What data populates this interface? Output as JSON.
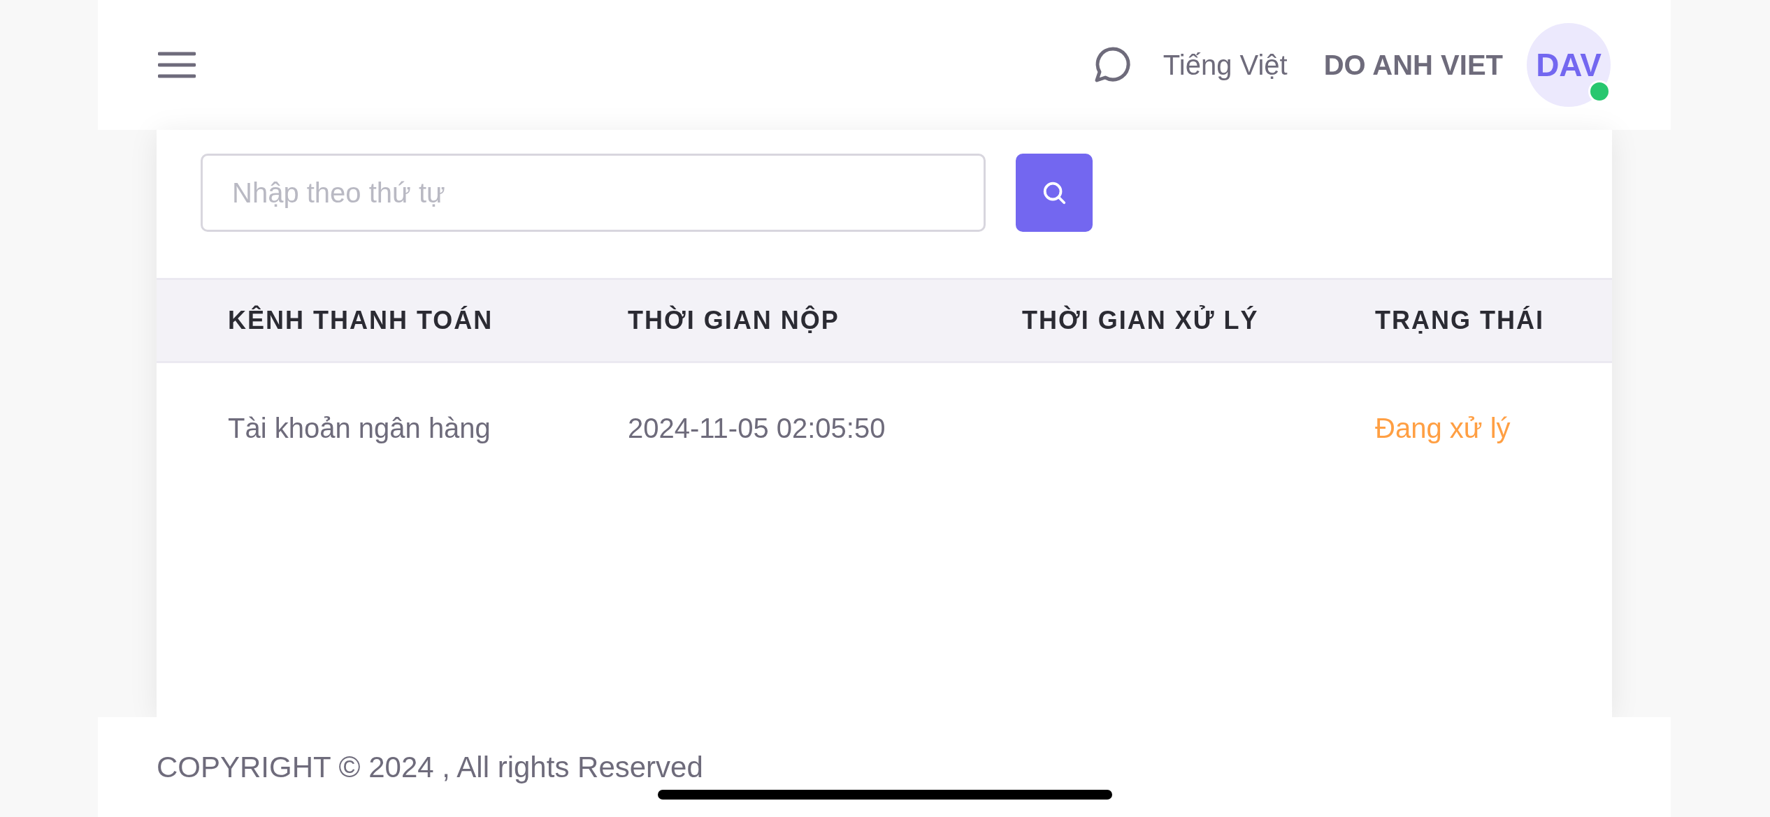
{
  "header": {
    "language": "Tiếng Việt",
    "user_name": "DO ANH VIET",
    "avatar_initials": "DAV",
    "online": true
  },
  "search": {
    "placeholder": "Nhập theo thứ tự"
  },
  "table": {
    "columns": [
      "KÊNH THANH TOÁN",
      "THỜI GIAN NỘP",
      "THỜI GIAN XỬ LÝ",
      "TRẠNG THÁI"
    ],
    "rows": [
      {
        "payment_channel": "Tài khoản ngân hàng",
        "submitted_at": "2024-11-05 02:05:50",
        "status": {
          "label": "Đang xử lý",
          "color": "#ff9f43"
        }
      }
    ]
  },
  "footer": {
    "copyright": "COPYRIGHT © 2024 , All rights Reserved"
  }
}
